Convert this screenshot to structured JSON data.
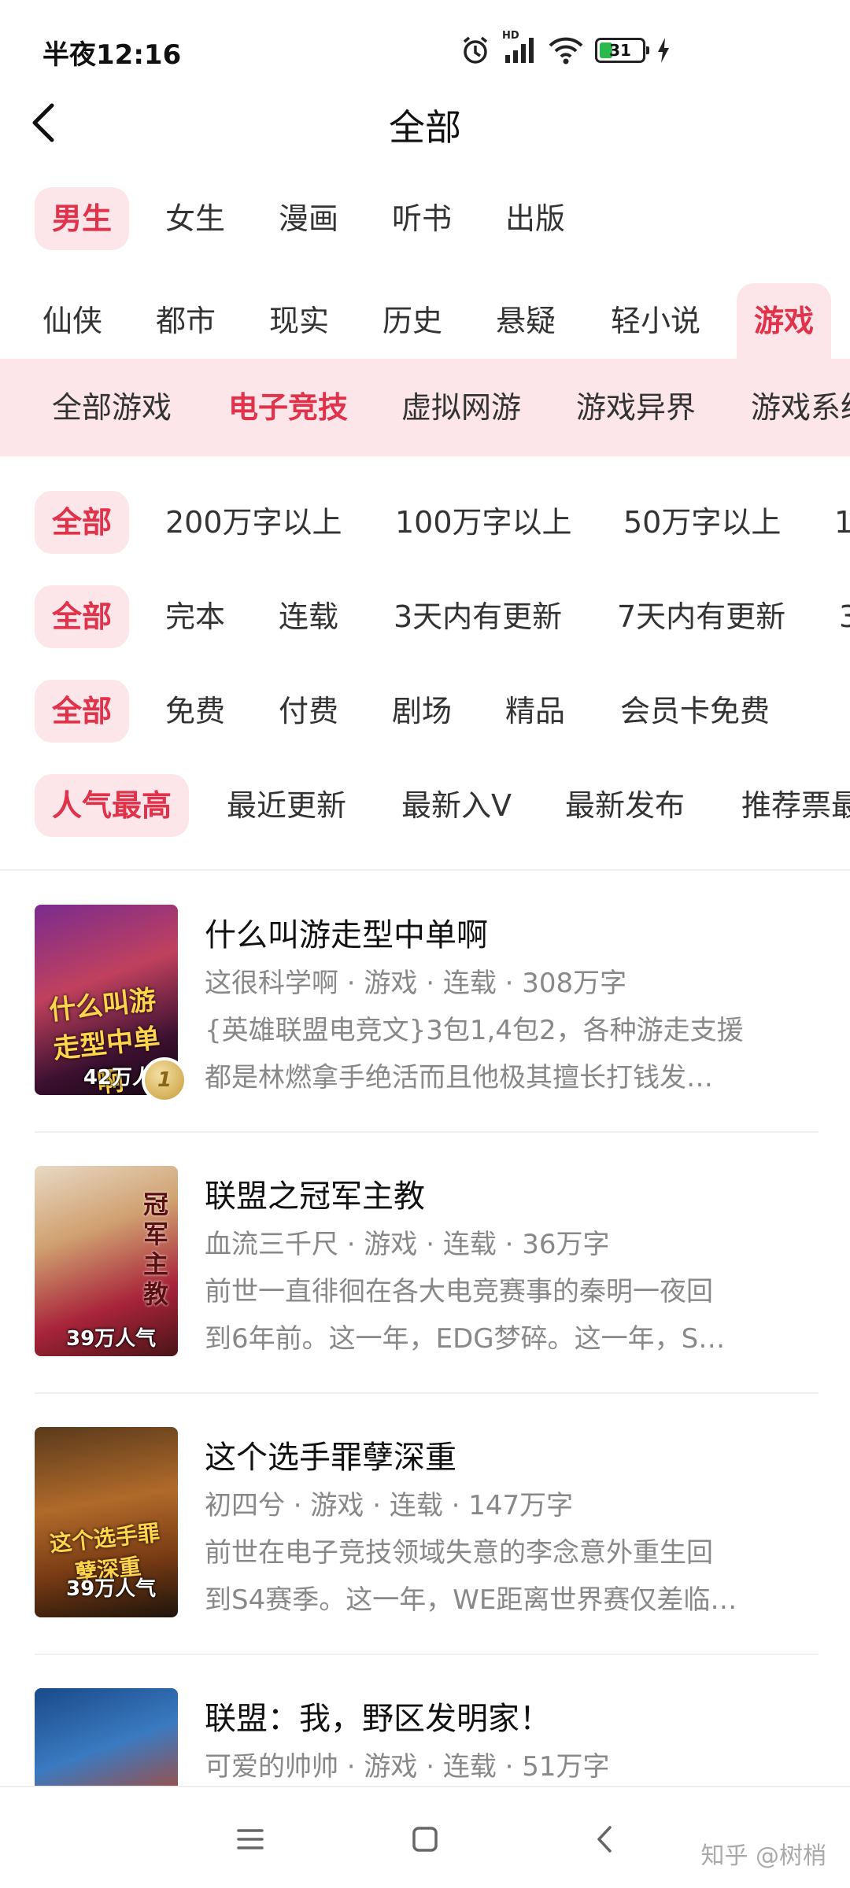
{
  "status_bar": {
    "time": "半夜12:16",
    "battery": "31",
    "battery_level": 0.31,
    "network": "HD"
  },
  "header": {
    "title": "全部"
  },
  "gender_tabs": [
    "男生",
    "女生",
    "漫画",
    "听书",
    "出版"
  ],
  "categories": [
    "仙侠",
    "都市",
    "现实",
    "历史",
    "悬疑",
    "轻小说",
    "游戏"
  ],
  "subcategories": [
    "全部游戏",
    "电子竞技",
    "虚拟网游",
    "游戏异界",
    "游戏系统"
  ],
  "filters": {
    "word_count": [
      "全部",
      "200万字以上",
      "100万字以上",
      "50万字以上",
      "1"
    ],
    "status": [
      "全部",
      "完本",
      "连载",
      "3天内有更新",
      "7天内有更新",
      "3"
    ],
    "price": [
      "全部",
      "免费",
      "付费",
      "剧场",
      "精品",
      "会员卡免费"
    ],
    "sort": [
      "人气最高",
      "最近更新",
      "最新入V",
      "最新发布",
      "推荐票最"
    ]
  },
  "books": [
    {
      "title": "什么叫游走型中单啊",
      "meta": "这很科学啊 · 游戏 · 连载 · 308万字",
      "desc1": "{英雄联盟电竞文}3包1,4包2，各种游走支援",
      "desc2": "都是林燃拿手绝活而且他极其擅长打钱发…",
      "cover_title": "什么叫游走型中单啊",
      "popularity": "42万人气",
      "rank": "1"
    },
    {
      "title": "联盟之冠军主教",
      "meta": "血流三千尺 · 游戏 · 连载 · 36万字",
      "desc1": "前世一直徘徊在各大电竞赛事的秦明一夜回",
      "desc2": "到6年前。这一年，EDG梦碎。这一年，S…",
      "cover_title": "冠军主教",
      "popularity": "39万人气"
    },
    {
      "title": "这个选手罪孽深重",
      "meta": "初四兮 · 游戏 · 连载 · 147万字",
      "desc1": "前世在电子竞技领域失意的李念意外重生回",
      "desc2": "到S4赛季。这一年，WE距离世界赛仅差临…",
      "cover_title": "这个选手罪孽深重",
      "popularity": "39万人气"
    },
    {
      "title": "联盟：我，野区发明家！",
      "meta": "可爱的帅帅 · 游戏 · 连载 · 51万字"
    }
  ],
  "watermark": "知乎 @树梢",
  "colors": {
    "accent": "#e0324a",
    "chip_bg": "#fde6e9"
  }
}
